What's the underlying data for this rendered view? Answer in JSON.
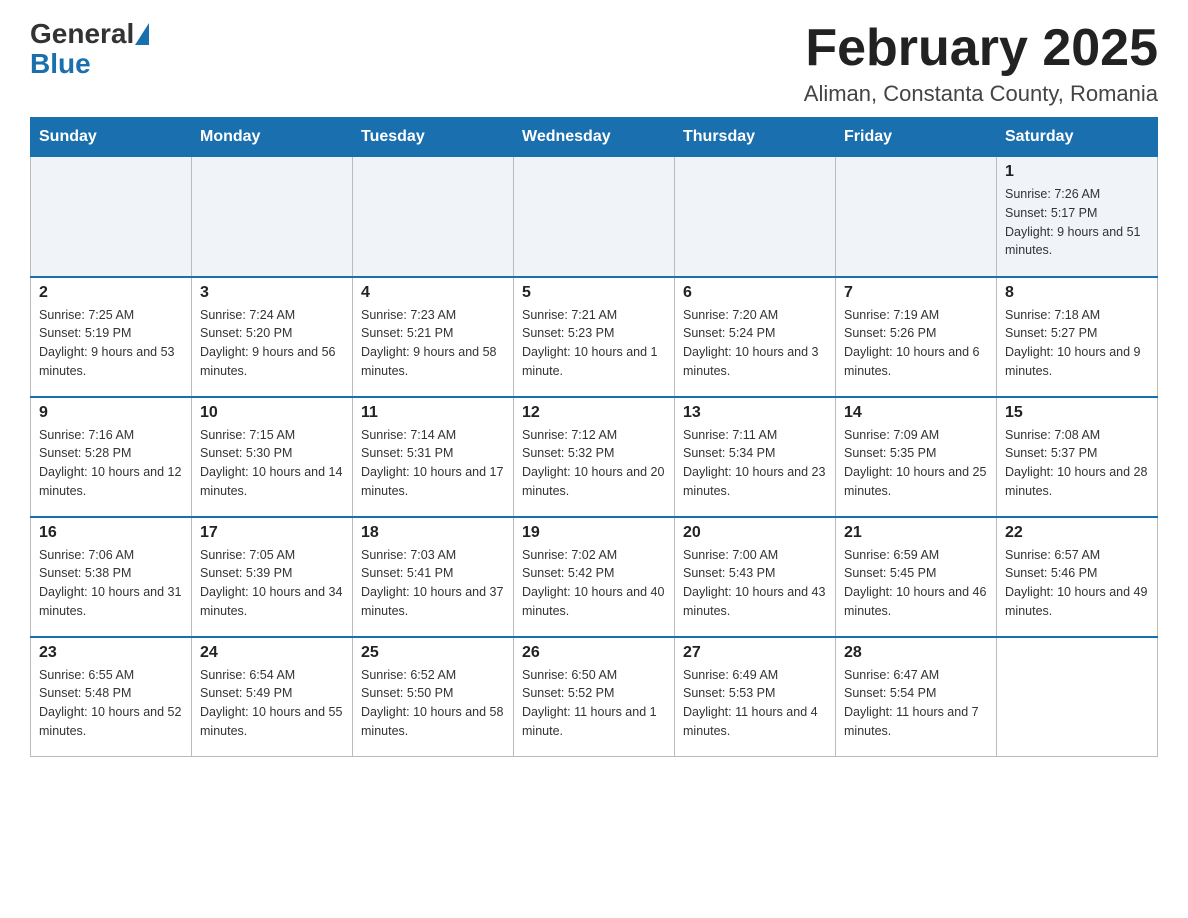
{
  "header": {
    "logo_general": "General",
    "logo_blue": "Blue",
    "month_title": "February 2025",
    "location": "Aliman, Constanta County, Romania"
  },
  "weekdays": [
    "Sunday",
    "Monday",
    "Tuesday",
    "Wednesday",
    "Thursday",
    "Friday",
    "Saturday"
  ],
  "weeks": [
    [
      {
        "day": "",
        "info": ""
      },
      {
        "day": "",
        "info": ""
      },
      {
        "day": "",
        "info": ""
      },
      {
        "day": "",
        "info": ""
      },
      {
        "day": "",
        "info": ""
      },
      {
        "day": "",
        "info": ""
      },
      {
        "day": "1",
        "info": "Sunrise: 7:26 AM\nSunset: 5:17 PM\nDaylight: 9 hours and 51 minutes."
      }
    ],
    [
      {
        "day": "2",
        "info": "Sunrise: 7:25 AM\nSunset: 5:19 PM\nDaylight: 9 hours and 53 minutes."
      },
      {
        "day": "3",
        "info": "Sunrise: 7:24 AM\nSunset: 5:20 PM\nDaylight: 9 hours and 56 minutes."
      },
      {
        "day": "4",
        "info": "Sunrise: 7:23 AM\nSunset: 5:21 PM\nDaylight: 9 hours and 58 minutes."
      },
      {
        "day": "5",
        "info": "Sunrise: 7:21 AM\nSunset: 5:23 PM\nDaylight: 10 hours and 1 minute."
      },
      {
        "day": "6",
        "info": "Sunrise: 7:20 AM\nSunset: 5:24 PM\nDaylight: 10 hours and 3 minutes."
      },
      {
        "day": "7",
        "info": "Sunrise: 7:19 AM\nSunset: 5:26 PM\nDaylight: 10 hours and 6 minutes."
      },
      {
        "day": "8",
        "info": "Sunrise: 7:18 AM\nSunset: 5:27 PM\nDaylight: 10 hours and 9 minutes."
      }
    ],
    [
      {
        "day": "9",
        "info": "Sunrise: 7:16 AM\nSunset: 5:28 PM\nDaylight: 10 hours and 12 minutes."
      },
      {
        "day": "10",
        "info": "Sunrise: 7:15 AM\nSunset: 5:30 PM\nDaylight: 10 hours and 14 minutes."
      },
      {
        "day": "11",
        "info": "Sunrise: 7:14 AM\nSunset: 5:31 PM\nDaylight: 10 hours and 17 minutes."
      },
      {
        "day": "12",
        "info": "Sunrise: 7:12 AM\nSunset: 5:32 PM\nDaylight: 10 hours and 20 minutes."
      },
      {
        "day": "13",
        "info": "Sunrise: 7:11 AM\nSunset: 5:34 PM\nDaylight: 10 hours and 23 minutes."
      },
      {
        "day": "14",
        "info": "Sunrise: 7:09 AM\nSunset: 5:35 PM\nDaylight: 10 hours and 25 minutes."
      },
      {
        "day": "15",
        "info": "Sunrise: 7:08 AM\nSunset: 5:37 PM\nDaylight: 10 hours and 28 minutes."
      }
    ],
    [
      {
        "day": "16",
        "info": "Sunrise: 7:06 AM\nSunset: 5:38 PM\nDaylight: 10 hours and 31 minutes."
      },
      {
        "day": "17",
        "info": "Sunrise: 7:05 AM\nSunset: 5:39 PM\nDaylight: 10 hours and 34 minutes."
      },
      {
        "day": "18",
        "info": "Sunrise: 7:03 AM\nSunset: 5:41 PM\nDaylight: 10 hours and 37 minutes."
      },
      {
        "day": "19",
        "info": "Sunrise: 7:02 AM\nSunset: 5:42 PM\nDaylight: 10 hours and 40 minutes."
      },
      {
        "day": "20",
        "info": "Sunrise: 7:00 AM\nSunset: 5:43 PM\nDaylight: 10 hours and 43 minutes."
      },
      {
        "day": "21",
        "info": "Sunrise: 6:59 AM\nSunset: 5:45 PM\nDaylight: 10 hours and 46 minutes."
      },
      {
        "day": "22",
        "info": "Sunrise: 6:57 AM\nSunset: 5:46 PM\nDaylight: 10 hours and 49 minutes."
      }
    ],
    [
      {
        "day": "23",
        "info": "Sunrise: 6:55 AM\nSunset: 5:48 PM\nDaylight: 10 hours and 52 minutes."
      },
      {
        "day": "24",
        "info": "Sunrise: 6:54 AM\nSunset: 5:49 PM\nDaylight: 10 hours and 55 minutes."
      },
      {
        "day": "25",
        "info": "Sunrise: 6:52 AM\nSunset: 5:50 PM\nDaylight: 10 hours and 58 minutes."
      },
      {
        "day": "26",
        "info": "Sunrise: 6:50 AM\nSunset: 5:52 PM\nDaylight: 11 hours and 1 minute."
      },
      {
        "day": "27",
        "info": "Sunrise: 6:49 AM\nSunset: 5:53 PM\nDaylight: 11 hours and 4 minutes."
      },
      {
        "day": "28",
        "info": "Sunrise: 6:47 AM\nSunset: 5:54 PM\nDaylight: 11 hours and 7 minutes."
      },
      {
        "day": "",
        "info": ""
      }
    ]
  ]
}
